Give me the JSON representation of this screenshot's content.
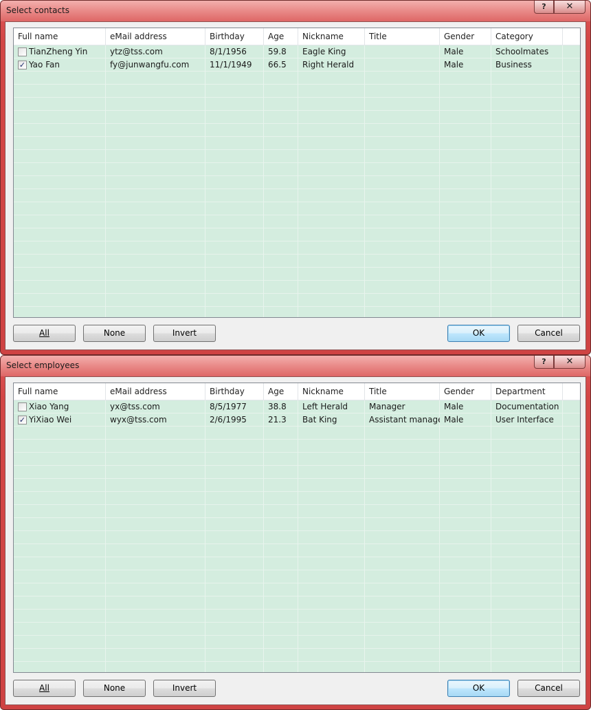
{
  "dialogs": [
    {
      "title": "Select contacts",
      "help_glyph": "?",
      "close_glyph": "✕",
      "columns": [
        "Full name",
        "eMail address",
        "Birthday",
        "Age",
        "Nickname",
        "Title",
        "Gender",
        "Category"
      ],
      "rows": [
        {
          "checked": false,
          "check_glyph": "",
          "cells": [
            "TianZheng Yin",
            "ytz@tss.com",
            "8/1/1956",
            "59.8",
            "Eagle King",
            "",
            "Male",
            "Schoolmates"
          ]
        },
        {
          "checked": true,
          "check_glyph": "✓",
          "cells": [
            "Yao Fan",
            "fy@junwangfu.com",
            "11/1/1949",
            "66.5",
            "Right Herald",
            "",
            "Male",
            "Business"
          ]
        }
      ],
      "buttons": {
        "all": "All",
        "none": "None",
        "invert": "Invert",
        "ok": "OK",
        "cancel": "Cancel"
      }
    },
    {
      "title": "Select employees",
      "help_glyph": "?",
      "close_glyph": "✕",
      "columns": [
        "Full name",
        "eMail address",
        "Birthday",
        "Age",
        "Nickname",
        "Title",
        "Gender",
        "Department"
      ],
      "rows": [
        {
          "checked": false,
          "check_glyph": "",
          "cells": [
            "Xiao Yang",
            "yx@tss.com",
            "8/5/1977",
            "38.8",
            "Left Herald",
            "Manager",
            "Male",
            "Documentation"
          ]
        },
        {
          "checked": true,
          "check_glyph": "✓",
          "cells": [
            "YiXiao Wei",
            "wyx@tss.com",
            "2/6/1995",
            "21.3",
            "Bat King",
            "Assistant manager",
            "Male",
            "User Interface"
          ]
        }
      ],
      "buttons": {
        "all": "All",
        "none": "None",
        "invert": "Invert",
        "ok": "OK",
        "cancel": "Cancel"
      }
    }
  ]
}
